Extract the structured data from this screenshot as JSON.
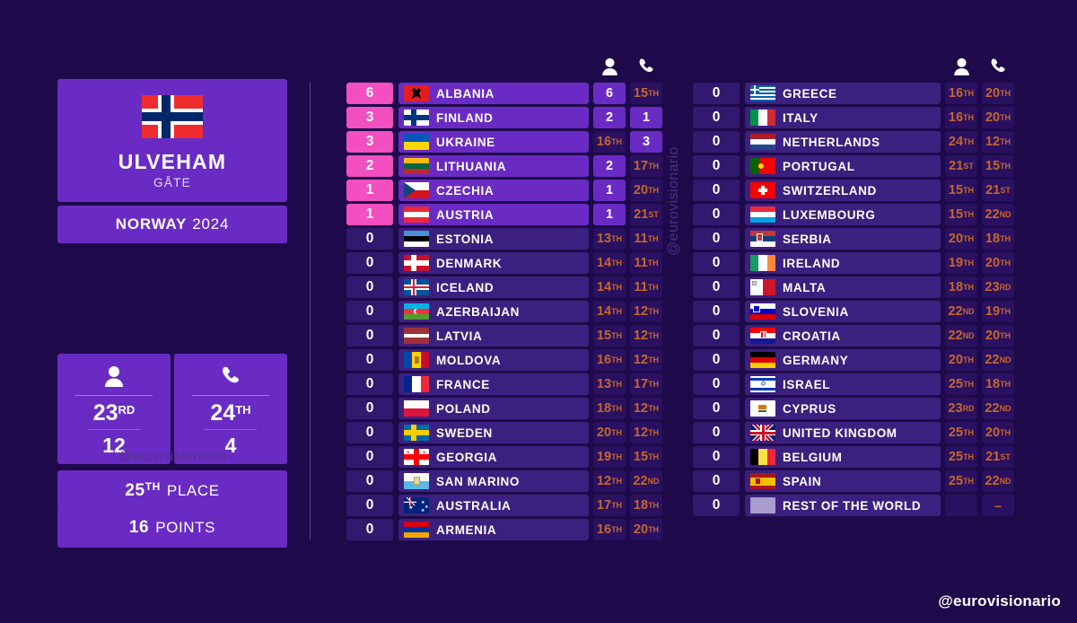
{
  "entry": {
    "flag_country": "Norway",
    "song": "ULVEHAM",
    "artist": "GÅTE",
    "country": "NORWAY",
    "year": "2024"
  },
  "stats": {
    "jury": {
      "icon": "person-icon",
      "rank": "23",
      "rank_suffix": "RD",
      "points": "12"
    },
    "televote": {
      "icon": "phone-icon",
      "rank": "24",
      "rank_suffix": "TH",
      "points": "4"
    },
    "final_place": {
      "value": "25",
      "suffix": "TH",
      "label": "PLACE"
    },
    "final_points": {
      "value": "16",
      "label": "POINTS"
    }
  },
  "watermark": "@eurovisionario",
  "watermark_corner": "@eurovisionario",
  "columns": {
    "jury_icon": "person-icon",
    "televote_icon": "phone-icon"
  },
  "table_left": [
    {
      "points": "6",
      "country": "ALBANIA",
      "flag": "al",
      "jury": "6",
      "jury_sup": "",
      "tele": "15",
      "tele_sup": "TH"
    },
    {
      "points": "3",
      "country": "FINLAND",
      "flag": "fi",
      "jury": "2",
      "jury_sup": "",
      "tele": "1",
      "tele_sup": ""
    },
    {
      "points": "3",
      "country": "UKRAINE",
      "flag": "ua",
      "jury": "16",
      "jury_sup": "TH",
      "tele": "3",
      "tele_sup": ""
    },
    {
      "points": "2",
      "country": "LITHUANIA",
      "flag": "lt",
      "jury": "2",
      "jury_sup": "",
      "tele": "17",
      "tele_sup": "TH"
    },
    {
      "points": "1",
      "country": "CZECHIA",
      "flag": "cz",
      "jury": "1",
      "jury_sup": "",
      "tele": "20",
      "tele_sup": "TH"
    },
    {
      "points": "1",
      "country": "AUSTRIA",
      "flag": "at",
      "jury": "1",
      "jury_sup": "",
      "tele": "21",
      "tele_sup": "ST"
    },
    {
      "points": "0",
      "country": "ESTONIA",
      "flag": "ee",
      "jury": "13",
      "jury_sup": "TH",
      "tele": "11",
      "tele_sup": "TH"
    },
    {
      "points": "0",
      "country": "DENMARK",
      "flag": "dk",
      "jury": "14",
      "jury_sup": "TH",
      "tele": "11",
      "tele_sup": "TH"
    },
    {
      "points": "0",
      "country": "ICELAND",
      "flag": "is",
      "jury": "14",
      "jury_sup": "TH",
      "tele": "11",
      "tele_sup": "TH"
    },
    {
      "points": "0",
      "country": "AZERBAIJAN",
      "flag": "az",
      "jury": "14",
      "jury_sup": "TH",
      "tele": "12",
      "tele_sup": "TH"
    },
    {
      "points": "0",
      "country": "LATVIA",
      "flag": "lv",
      "jury": "15",
      "jury_sup": "TH",
      "tele": "12",
      "tele_sup": "TH"
    },
    {
      "points": "0",
      "country": "MOLDOVA",
      "flag": "md",
      "jury": "16",
      "jury_sup": "TH",
      "tele": "12",
      "tele_sup": "TH"
    },
    {
      "points": "0",
      "country": "FRANCE",
      "flag": "fr",
      "jury": "13",
      "jury_sup": "TH",
      "tele": "17",
      "tele_sup": "TH"
    },
    {
      "points": "0",
      "country": "POLAND",
      "flag": "pl",
      "jury": "18",
      "jury_sup": "TH",
      "tele": "12",
      "tele_sup": "TH"
    },
    {
      "points": "0",
      "country": "SWEDEN",
      "flag": "se",
      "jury": "20",
      "jury_sup": "TH",
      "tele": "12",
      "tele_sup": "TH"
    },
    {
      "points": "0",
      "country": "GEORGIA",
      "flag": "ge",
      "jury": "19",
      "jury_sup": "TH",
      "tele": "15",
      "tele_sup": "TH"
    },
    {
      "points": "0",
      "country": "SAN MARINO",
      "flag": "sm",
      "jury": "12",
      "jury_sup": "TH",
      "tele": "22",
      "tele_sup": "ND"
    },
    {
      "points": "0",
      "country": "AUSTRALIA",
      "flag": "au",
      "jury": "17",
      "jury_sup": "TH",
      "tele": "18",
      "tele_sup": "TH"
    },
    {
      "points": "0",
      "country": "ARMENIA",
      "flag": "am",
      "jury": "16",
      "jury_sup": "TH",
      "tele": "20",
      "tele_sup": "TH"
    }
  ],
  "table_right": [
    {
      "points": "0",
      "country": "GREECE",
      "flag": "gr",
      "jury": "16",
      "jury_sup": "TH",
      "tele": "20",
      "tele_sup": "TH"
    },
    {
      "points": "0",
      "country": "ITALY",
      "flag": "it",
      "jury": "16",
      "jury_sup": "TH",
      "tele": "20",
      "tele_sup": "TH"
    },
    {
      "points": "0",
      "country": "NETHERLANDS",
      "flag": "nl",
      "jury": "24",
      "jury_sup": "TH",
      "tele": "12",
      "tele_sup": "TH"
    },
    {
      "points": "0",
      "country": "PORTUGAL",
      "flag": "pt",
      "jury": "21",
      "jury_sup": "ST",
      "tele": "15",
      "tele_sup": "TH"
    },
    {
      "points": "0",
      "country": "SWITZERLAND",
      "flag": "ch",
      "jury": "15",
      "jury_sup": "TH",
      "tele": "21",
      "tele_sup": "ST"
    },
    {
      "points": "0",
      "country": "LUXEMBOURG",
      "flag": "lu",
      "jury": "15",
      "jury_sup": "TH",
      "tele": "22",
      "tele_sup": "ND"
    },
    {
      "points": "0",
      "country": "SERBIA",
      "flag": "rs",
      "jury": "20",
      "jury_sup": "TH",
      "tele": "18",
      "tele_sup": "TH"
    },
    {
      "points": "0",
      "country": "IRELAND",
      "flag": "ie",
      "jury": "19",
      "jury_sup": "TH",
      "tele": "20",
      "tele_sup": "TH"
    },
    {
      "points": "0",
      "country": "MALTA",
      "flag": "mt",
      "jury": "18",
      "jury_sup": "TH",
      "tele": "23",
      "tele_sup": "RD"
    },
    {
      "points": "0",
      "country": "SLOVENIA",
      "flag": "si",
      "jury": "22",
      "jury_sup": "ND",
      "tele": "19",
      "tele_sup": "TH"
    },
    {
      "points": "0",
      "country": "CROATIA",
      "flag": "hr",
      "jury": "22",
      "jury_sup": "ND",
      "tele": "20",
      "tele_sup": "TH"
    },
    {
      "points": "0",
      "country": "GERMANY",
      "flag": "de",
      "jury": "20",
      "jury_sup": "TH",
      "tele": "22",
      "tele_sup": "ND"
    },
    {
      "points": "0",
      "country": "ISRAEL",
      "flag": "il",
      "jury": "25",
      "jury_sup": "TH",
      "tele": "18",
      "tele_sup": "TH"
    },
    {
      "points": "0",
      "country": "CYPRUS",
      "flag": "cy",
      "jury": "23",
      "jury_sup": "RD",
      "tele": "22",
      "tele_sup": "ND"
    },
    {
      "points": "0",
      "country": "UNITED KINGDOM",
      "flag": "gb",
      "jury": "25",
      "jury_sup": "TH",
      "tele": "20",
      "tele_sup": "TH"
    },
    {
      "points": "0",
      "country": "BELGIUM",
      "flag": "be",
      "jury": "25",
      "jury_sup": "TH",
      "tele": "21",
      "tele_sup": "ST"
    },
    {
      "points": "0",
      "country": "SPAIN",
      "flag": "es",
      "jury": "25",
      "jury_sup": "TH",
      "tele": "22",
      "tele_sup": "ND"
    },
    {
      "points": "0",
      "country": "REST OF THE WORLD",
      "flag": "row",
      "jury": "",
      "jury_sup": "",
      "tele": "-",
      "tele_sup": ""
    }
  ],
  "colors": {
    "background": "#1e0a4a",
    "panel": "#6a2bc4",
    "points_badge": "#f24fc0",
    "zero_badge": "#32186e",
    "row_zero": "#3c2080",
    "rank_low_text": "#c4672e",
    "rank_low_bg": "#2a1060"
  }
}
